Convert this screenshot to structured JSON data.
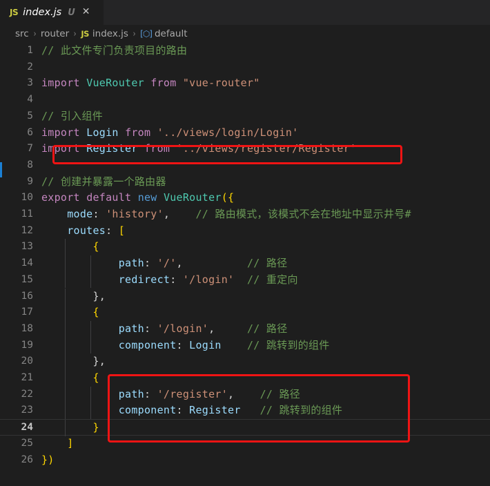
{
  "window": {
    "app": "vscode-editor",
    "theme": "dark-plus"
  },
  "tab": {
    "file_icon": "js-file-icon",
    "filename": "index.js",
    "git_status": "U",
    "close_glyph": "✕"
  },
  "breadcrumb": {
    "separator": "›",
    "items": [
      {
        "label": "src",
        "icon": null
      },
      {
        "label": "router",
        "icon": null
      },
      {
        "label": "index.js",
        "icon": "js-file-icon"
      },
      {
        "label": "default",
        "icon": "symbol-module-icon"
      }
    ],
    "js_icon_text": "JS",
    "symbol_icon_glyph": "⬡"
  },
  "colors": {
    "editor_background": "#1e1e1e",
    "tabbar_background": "#252526",
    "comment": "#6A9955",
    "keyword": "#C586C0",
    "keyword_control": "#569CD6",
    "class_name": "#4EC9B0",
    "variable": "#9CDCFE",
    "string": "#CE9178",
    "punctuation": "#d4d4d4",
    "line_number": "#858585",
    "annotation_red": "#f01414",
    "decoration_blue": "#1b80d4"
  },
  "editor": {
    "current_line": 24,
    "total_lines": 26,
    "language": "javascript",
    "lines": [
      {
        "n": 1,
        "text": "// 此文件专门负责项目的路由"
      },
      {
        "n": 2,
        "text": ""
      },
      {
        "n": 3,
        "text": "import VueRouter from \"vue-router\""
      },
      {
        "n": 4,
        "text": ""
      },
      {
        "n": 5,
        "text": "// 引入组件"
      },
      {
        "n": 6,
        "text": "import Login from '../views/login/Login'"
      },
      {
        "n": 7,
        "text": "import Register from '../views/register/Register'"
      },
      {
        "n": 8,
        "text": ""
      },
      {
        "n": 9,
        "text": "// 创建并暴露一个路由器"
      },
      {
        "n": 10,
        "text": "export default new VueRouter({"
      },
      {
        "n": 11,
        "text": "    mode: 'history',    // 路由模式，该模式不会在地址中显示井号#"
      },
      {
        "n": 12,
        "text": "    routes: ["
      },
      {
        "n": 13,
        "text": "        {"
      },
      {
        "n": 14,
        "text": "            path: '/',          // 路径"
      },
      {
        "n": 15,
        "text": "            redirect: '/login'  // 重定向"
      },
      {
        "n": 16,
        "text": "        },"
      },
      {
        "n": 17,
        "text": "        {"
      },
      {
        "n": 18,
        "text": "            path: '/login',     // 路径"
      },
      {
        "n": 19,
        "text": "            component: Login    // 跳转到的组件"
      },
      {
        "n": 20,
        "text": "        },"
      },
      {
        "n": 21,
        "text": "        {"
      },
      {
        "n": 22,
        "text": "            path: '/register',    // 路径"
      },
      {
        "n": 23,
        "text": "            component: Register   // 跳转到的组件"
      },
      {
        "n": 24,
        "text": "        }"
      },
      {
        "n": 25,
        "text": "    ]"
      },
      {
        "n": 26,
        "text": "})"
      }
    ]
  },
  "annotations": [
    {
      "name": "highlight-import-register",
      "lines": [
        7
      ],
      "color": "#f01414"
    },
    {
      "name": "highlight-register-route",
      "lines": [
        21,
        22,
        23,
        24
      ],
      "color": "#f01414"
    }
  ]
}
